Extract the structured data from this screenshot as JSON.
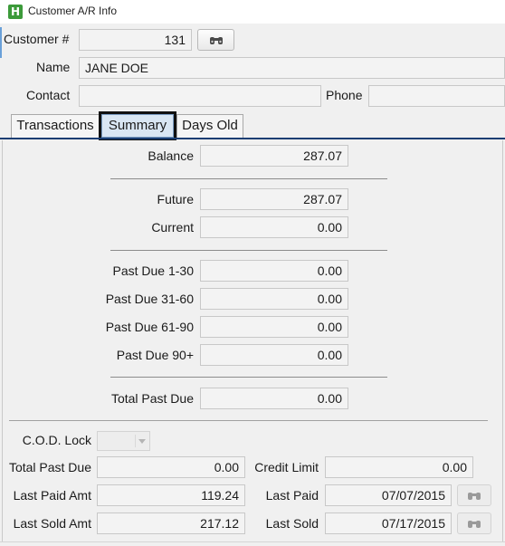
{
  "window": {
    "title": "Customer A/R Info",
    "icon_letter": "H",
    "icon_color": "#3c9a3a"
  },
  "header": {
    "customer_label": "Customer #",
    "customer_value": "131",
    "name_label": "Name",
    "name_value": "JANE DOE",
    "contact_label": "Contact",
    "contact_value": "",
    "phone_label": "Phone",
    "phone_value": ""
  },
  "tabs": [
    {
      "label": "Transactions",
      "active": false
    },
    {
      "label": "Summary",
      "active": true
    },
    {
      "label": "Days Old",
      "active": false
    }
  ],
  "summary": {
    "balance_label": "Balance",
    "balance_value": "287.07",
    "future_label": "Future",
    "future_value": "287.07",
    "current_label": "Current",
    "current_value": "0.00",
    "pd_1_30_label": "Past Due 1-30",
    "pd_1_30_value": "0.00",
    "pd_31_60_label": "Past Due 31-60",
    "pd_31_60_value": "0.00",
    "pd_61_90_label": "Past Due 61-90",
    "pd_61_90_value": "0.00",
    "pd_90_label": "Past Due 90+",
    "pd_90_value": "0.00",
    "total_past_due_label": "Total Past Due",
    "total_past_due_value": "0.00"
  },
  "footer": {
    "cod_lock_label": "C.O.D. Lock",
    "cod_lock_value": "",
    "total_past_due_label": "Total Past Due",
    "total_past_due_value": "0.00",
    "credit_limit_label": "Credit Limit",
    "credit_limit_value": "0.00",
    "last_paid_amt_label": "Last Paid Amt",
    "last_paid_amt_value": "119.24",
    "last_paid_label": "Last Paid",
    "last_paid_value": "07/07/2015",
    "last_sold_amt_label": "Last Sold Amt",
    "last_sold_amt_value": "217.12",
    "last_sold_label": "Last Sold",
    "last_sold_value": "07/17/2015"
  },
  "icons": {
    "lookup": "binoculars-icon"
  },
  "colors": {
    "active_tab_bg": "#d9e6f3",
    "tab_underline": "#1b3e73"
  }
}
